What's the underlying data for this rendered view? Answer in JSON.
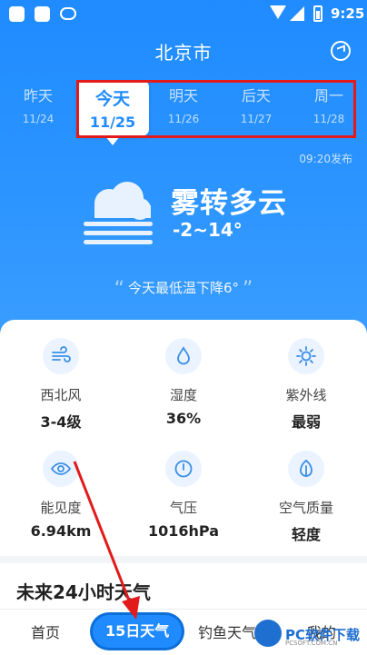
{
  "status": {
    "time": "9:25"
  },
  "header": {
    "city": "北京市"
  },
  "days": [
    {
      "name": "昨天",
      "date": "11/24",
      "active": false
    },
    {
      "name": "今天",
      "date": "11/25",
      "active": true
    },
    {
      "name": "明天",
      "date": "11/26",
      "active": false
    },
    {
      "name": "后天",
      "date": "11/27",
      "active": false
    },
    {
      "name": "周一",
      "date": "11/28",
      "active": false
    }
  ],
  "weather": {
    "publish_time": "09:20发布",
    "condition": "雾转多云",
    "temperature": "-2~14°",
    "tip": "今天最低温下降6°"
  },
  "details": [
    {
      "label": "西北风",
      "value": "3-4级",
      "icon": "wind-icon"
    },
    {
      "label": "湿度",
      "value": "36%",
      "icon": "humidity-drop-icon"
    },
    {
      "label": "紫外线",
      "value": "最弱",
      "icon": "sun-icon"
    },
    {
      "label": "能见度",
      "value": "6.94km",
      "icon": "eye-icon"
    },
    {
      "label": "气压",
      "value": "1016hPa",
      "icon": "pressure-gauge-icon"
    },
    {
      "label": "空气质量",
      "value": "轻度",
      "icon": "leaf-icon"
    }
  ],
  "section": {
    "title": "未来24小时天气"
  },
  "nav": {
    "home": "首页",
    "fifteen_day": "15日天气",
    "fishing": "钓鱼天气",
    "mine": "我的"
  },
  "watermark": {
    "text": "PC软件下载",
    "sub": "PCSOFT.COM.CN"
  },
  "colors": {
    "primary": "#1f8bff",
    "highlight": "#e21a1a"
  }
}
